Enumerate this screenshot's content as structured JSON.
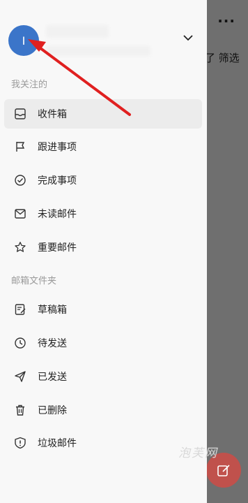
{
  "background_app": {
    "more_label": "···",
    "filter_label": "了 筛选"
  },
  "account": {
    "avatar_letter": "I"
  },
  "sections": {
    "following_label": "我关注的",
    "folders_label": "邮箱文件夹"
  },
  "following_items": [
    {
      "label": "收件箱",
      "icon": "inbox-icon",
      "selected": true
    },
    {
      "label": "跟进事项",
      "icon": "flag-icon"
    },
    {
      "label": "完成事项",
      "icon": "check-circle-icon"
    },
    {
      "label": "未读邮件",
      "icon": "envelope-icon"
    },
    {
      "label": "重要邮件",
      "icon": "star-icon"
    }
  ],
  "folder_items": [
    {
      "label": "草稿箱",
      "icon": "draft-icon"
    },
    {
      "label": "待发送",
      "icon": "clock-icon"
    },
    {
      "label": "已发送",
      "icon": "send-icon"
    },
    {
      "label": "已删除",
      "icon": "trash-icon"
    },
    {
      "label": "垃圾邮件",
      "icon": "spam-icon"
    }
  ],
  "watermark": "泡芙网",
  "colors": {
    "avatar": "#3b75c9",
    "fab": "#c0514c",
    "annotation_arrow": "#e02020"
  }
}
